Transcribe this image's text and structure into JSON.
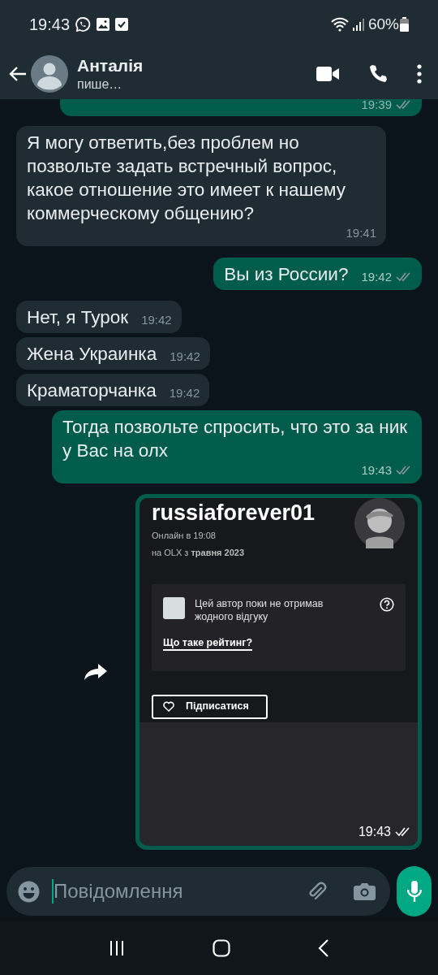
{
  "status_bar": {
    "time": "19:43",
    "battery": "60%"
  },
  "header": {
    "name": "Анталія",
    "status": "пише…"
  },
  "messages": [
    {
      "kind": "clipped",
      "outgoing": true,
      "time": "19:39",
      "read": false
    },
    {
      "kind": "text",
      "outgoing": false,
      "text": "Я могу ответить,без проблем но позвольте задать встречный вопрос, какое отношение это имеет к нашему коммерческому общению?",
      "time": "19:41"
    },
    {
      "kind": "text",
      "outgoing": true,
      "text": "Вы из России?",
      "time": "19:42",
      "read": false
    },
    {
      "kind": "text",
      "outgoing": false,
      "text": "Нет, я Турок",
      "time": "19:42"
    },
    {
      "kind": "text",
      "outgoing": false,
      "text": "Жена Украинка",
      "time": "19:42"
    },
    {
      "kind": "text",
      "outgoing": false,
      "text": "Краматорчанка",
      "time": "19:42"
    },
    {
      "kind": "text",
      "outgoing": true,
      "text": "Тогда позвольте спросить, что это за ник у Вас на олх",
      "time": "19:43",
      "read": false
    },
    {
      "kind": "screenshot",
      "outgoing": true,
      "time": "19:43",
      "read": false,
      "forward": true,
      "screenshot": {
        "username": "russiaforever01",
        "online": "Онлайн в 19:08",
        "since": "на OLX з **травня 2023**",
        "review_note": "Цей автор поки не отримав жодного відгуку",
        "rating_link": "Що таке рейтинг?",
        "follow_button": "Підписатися"
      }
    }
  ],
  "composer": {
    "placeholder": "Повідомлення"
  }
}
